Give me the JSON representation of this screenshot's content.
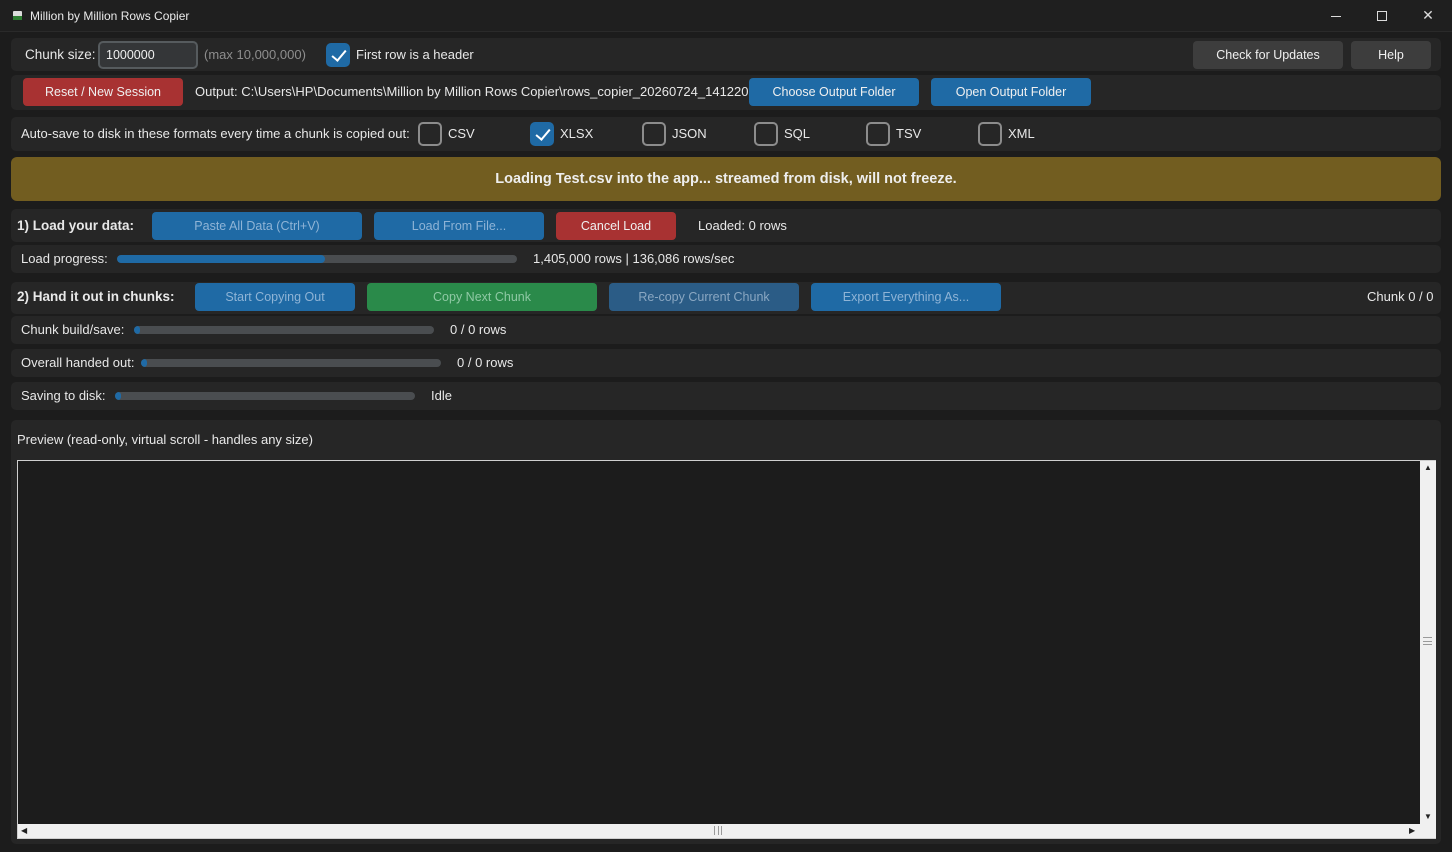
{
  "window": {
    "title": "Million by Million Rows Copier",
    "minimize": "—",
    "maximize": "☐",
    "close": "✕"
  },
  "settings": {
    "chunk_size_label": "Chunk size:",
    "chunk_size_value": "1000000",
    "chunk_size_hint": "(max 10,000,000)",
    "first_row_header_label": "First row is a header",
    "first_row_header_checked": true,
    "check_updates": "Check for Updates",
    "help": "Help"
  },
  "output": {
    "reset_button": "Reset / New Session",
    "path": "Output: C:\\Users\\HP\\Documents\\Million by Million Rows Copier\\rows_copier_20260724_141220",
    "choose_folder": "Choose Output Folder",
    "open_folder": "Open Output Folder"
  },
  "autosave": {
    "label": "Auto-save to disk in these formats every time a chunk is copied out:",
    "formats": [
      {
        "name": "CSV",
        "checked": false
      },
      {
        "name": "XLSX",
        "checked": true
      },
      {
        "name": "JSON",
        "checked": false
      },
      {
        "name": "SQL",
        "checked": false
      },
      {
        "name": "TSV",
        "checked": false
      },
      {
        "name": "XML",
        "checked": false
      }
    ]
  },
  "banner": {
    "text": "Loading Test.csv into the app... streamed from disk, will not freeze.",
    "color": "#725d20"
  },
  "load": {
    "heading": "1) Load your data:",
    "paste_button": "Paste All Data (Ctrl+V)",
    "load_file_button": "Load From File...",
    "cancel_button": "Cancel Load",
    "loaded_status": "Loaded: 0 rows",
    "progress_label": "Load progress:",
    "progress_fraction": 0.52,
    "progress_text": "1,405,000 rows  |  136,086 rows/sec"
  },
  "chunks": {
    "heading": "2) Hand it out in chunks:",
    "start_button": "Start Copying Out",
    "next_button": "Copy Next Chunk",
    "recopy_button": "Re-copy Current Chunk",
    "export_button": "Export Everything As...",
    "chunk_counter": "Chunk 0 / 0"
  },
  "progress": {
    "chunk_build_label": "Chunk build/save:",
    "chunk_build_fraction": 0.02,
    "chunk_build_text": "0 / 0 rows",
    "overall_label": "Overall handed out:",
    "overall_fraction": 0.02,
    "overall_text": "0 / 0 rows",
    "saving_label": "Saving to disk:",
    "saving_fraction": 0.02,
    "saving_text": "Idle"
  },
  "preview": {
    "label": "Preview (read-only, virtual scroll - handles any size)"
  },
  "colors": {
    "accent": "#1f6aa5",
    "danger": "#a83232",
    "success": "#2a8a4a",
    "background": "#1c1c1c"
  }
}
